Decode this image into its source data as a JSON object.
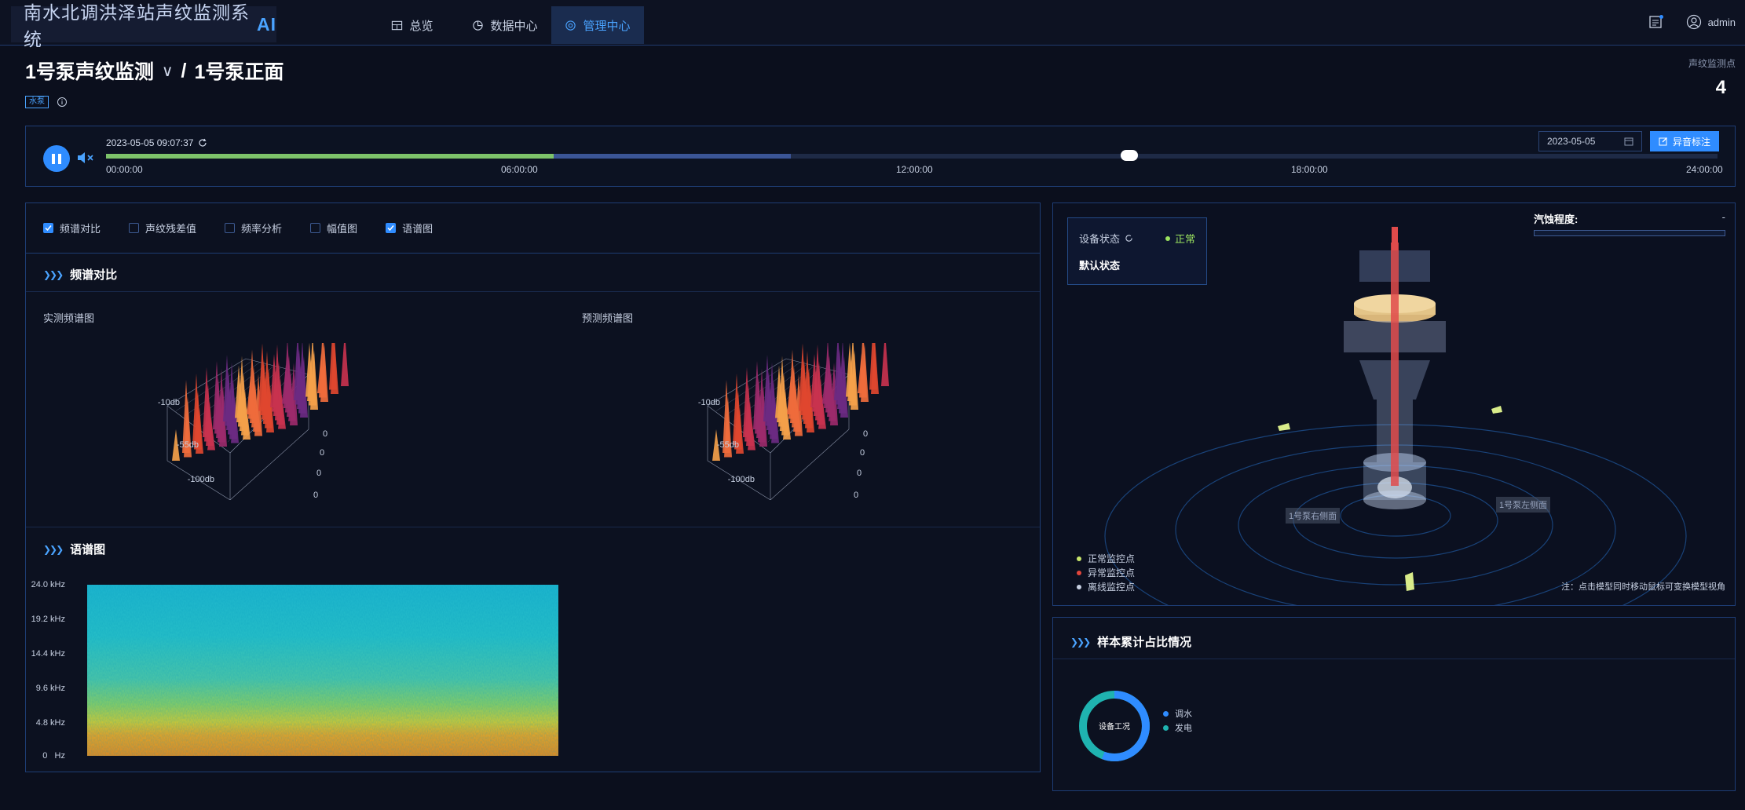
{
  "app": {
    "title": "南水北调洪泽站声纹监测系统",
    "ai_badge": "AI"
  },
  "nav": {
    "tabs": [
      {
        "label": "总览",
        "icon": "grid-icon"
      },
      {
        "label": "数据中心",
        "icon": "pie-icon"
      },
      {
        "label": "管理中心",
        "icon": "target-icon",
        "active": true
      }
    ]
  },
  "header": {
    "user": "admin"
  },
  "page": {
    "title": "1号泵声纹监测",
    "separator": "/",
    "subtitle": "1号泵正面",
    "tag": "水泵"
  },
  "counter": {
    "label": "声纹监测点",
    "value": "4"
  },
  "timeline": {
    "timestamp": "2023-05-05 09:07:37",
    "ticks": [
      "00:00:00",
      "06:00:00",
      "12:00:00",
      "18:00:00",
      "24:00:00"
    ],
    "played_fraction": 0.278,
    "loaded_fraction": 0.425,
    "position_fraction": 0.635,
    "date": "2023-05-05",
    "mark_button": "异音标注"
  },
  "checks": [
    {
      "label": "频谱对比",
      "checked": true
    },
    {
      "label": "声纹残差值",
      "checked": false
    },
    {
      "label": "频率分析",
      "checked": false
    },
    {
      "label": "幅值图",
      "checked": false
    },
    {
      "label": "语谱图",
      "checked": true
    }
  ],
  "spectrum_section": {
    "title": "频谱对比",
    "measured_label": "实测频谱图",
    "predicted_label": "预测频谱图",
    "z_ticks": [
      "-10db",
      "-55db",
      "-100db"
    ],
    "side_ticks": [
      "0",
      "0",
      "0",
      "0"
    ]
  },
  "spectrogram_section": {
    "title": "语谱图",
    "y_ticks": [
      "24.0 kHz",
      "19.2 kHz",
      "14.4 kHz",
      "9.6 kHz",
      "4.8 kHz",
      "0   Hz"
    ]
  },
  "model": {
    "status_label": "设备状态",
    "status_value": "正常",
    "default_state": "默认状态",
    "erosion_label": "汽蚀程度:",
    "erosion_value": "-",
    "point_right": "1号泵右侧面",
    "point_left": "1号泵左侧面",
    "legend": [
      {
        "label": "正常监控点",
        "color": "#c8e66b"
      },
      {
        "label": "异常监控点",
        "color": "#e2453b"
      },
      {
        "label": "离线监控点",
        "color": "#c7d0e2"
      }
    ],
    "note": "注：点击模型同时移动鼠标可变换模型视角"
  },
  "samples": {
    "title": "样本累计占比情况",
    "center_label": "设备工况",
    "legend": [
      {
        "label": "调水",
        "color": "#2f8cff"
      },
      {
        "label": "发电",
        "color": "#1fb3b0"
      }
    ]
  }
}
